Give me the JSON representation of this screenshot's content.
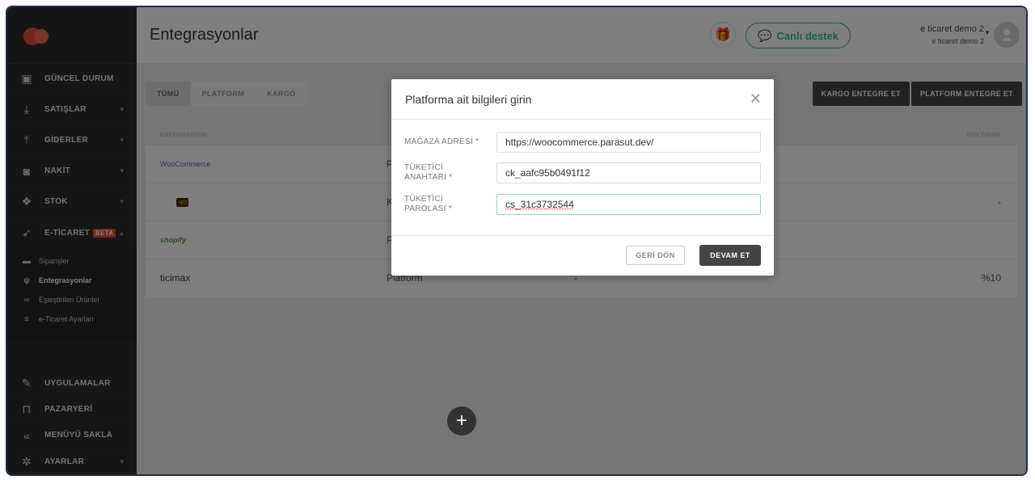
{
  "sidebar": {
    "logo_color": "#e84c3d",
    "items": [
      {
        "label": "GÜNCEL DURUM",
        "icon": "dashboard-icon"
      },
      {
        "label": "SATIŞLAR",
        "icon": "download-icon"
      },
      {
        "label": "GİDERLER",
        "icon": "upload-icon"
      },
      {
        "label": "NAKİT",
        "icon": "cash-icon"
      },
      {
        "label": "STOK",
        "icon": "cubes-icon"
      },
      {
        "label": "E-TİCARET",
        "icon": "rocket-icon",
        "badge": "BETA"
      }
    ],
    "sub_items": [
      {
        "label": "Siparişler",
        "icon": "orders-icon"
      },
      {
        "label": "Entegrasyonlar",
        "icon": "plug-icon"
      },
      {
        "label": "Eşleştirilen Ürünler",
        "icon": "link-icon"
      },
      {
        "label": "e-Ticaret Ayarları",
        "icon": "sliders-icon"
      }
    ],
    "bottom_items": [
      {
        "label": "UYGULAMALAR",
        "icon": "apps-icon"
      },
      {
        "label": "PAZARYERİ",
        "icon": "cart-icon"
      },
      {
        "label": "MENÜYÜ SAKLA",
        "icon": "collapse-icon"
      },
      {
        "label": "AYARLAR",
        "icon": "gear-icon"
      }
    ]
  },
  "header": {
    "title": "Entegrasyonlar",
    "support_label": "Canlı destek",
    "user_name": "e ticaret demo 2",
    "user_company": "e ticaret demo 2"
  },
  "main": {
    "tabs": [
      "TÜMÜ",
      "PLATFORM",
      "KARGO"
    ],
    "buttons": {
      "kargo": "KARGO ENTEGRE ET",
      "platform": "PLATFORM ENTEGRE ET"
    },
    "columns": {
      "entegrasyon": "ENTEGRASYON",
      "kdv": "KDV ORANI"
    },
    "rows": [
      {
        "logo": "WooCommerce",
        "type": "P",
        "dash": "",
        "kdv": ""
      },
      {
        "logo": "ups",
        "type": "K",
        "dash": "",
        "kdv": "-"
      },
      {
        "logo": "shopify",
        "type": "P",
        "dash": "",
        "kdv": ""
      },
      {
        "logo": "ticimax",
        "type": "Platform",
        "dash": "-",
        "kdv": "%10"
      }
    ]
  },
  "modal": {
    "title": "Platforma ait bilgileri girin",
    "fields": [
      {
        "label": "MAĞAZA ADRESİ *",
        "value": "https://woocommerce.parasut.dev/"
      },
      {
        "label": "TÜKETİCİ ANAHTARI *",
        "value": "ck_aafc95b0491f12"
      },
      {
        "label": "TÜKETİCİ PAROLASI *",
        "value": "cs_31c3732544"
      }
    ],
    "back_label": "GERİ DÖN",
    "next_label": "DEVAM ET"
  },
  "colors": {
    "accent": "#2fbf8e",
    "beta": "#e84c3d",
    "dark_button": "#444444"
  }
}
